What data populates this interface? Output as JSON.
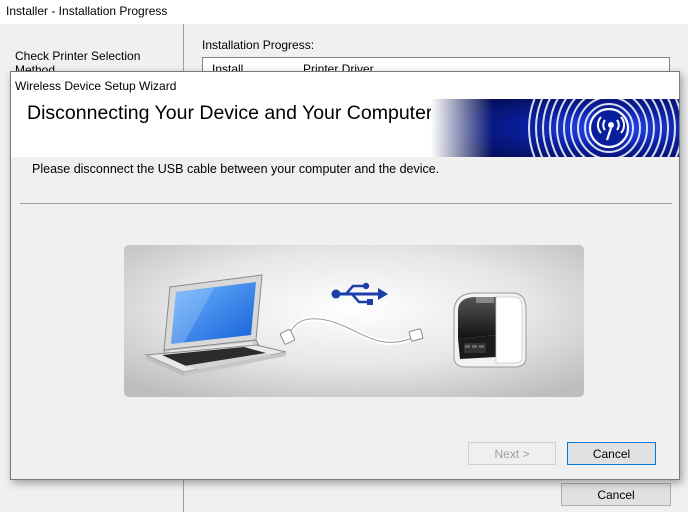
{
  "background_window": {
    "title": "Installer - Installation Progress",
    "steps": [
      "Check Printer Selection",
      "Method"
    ],
    "progress_label": "Installation Progress:",
    "list_row": {
      "col1": "Install",
      "col2": "Printer Driver"
    },
    "cancel_label": "Cancel"
  },
  "wizard": {
    "title": "Wireless Device Setup Wizard",
    "heading": "Disconnecting Your Device and Your Computer",
    "message": "Please disconnect the USB cable between your computer and the device.",
    "next_label": "Next >",
    "cancel_label": "Cancel"
  },
  "icons": {
    "wireless_logo": "wireless-signal-icon",
    "usb": "usb-icon",
    "laptop": "laptop-icon",
    "cable": "usb-cable-icon",
    "printer": "label-printer-icon"
  },
  "colors": {
    "banner_blue": "#0a1f9e",
    "banner_dark": "#030a4a",
    "usb_blue": "#1a3fa8",
    "focus_border": "#0078d7"
  }
}
